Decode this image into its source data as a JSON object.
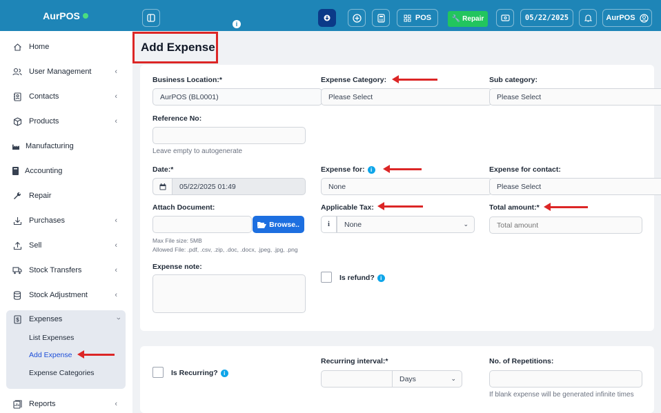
{
  "brand": {
    "name": "AurPOS"
  },
  "topbar": {
    "pos_label": "POS",
    "repair_label": "Repair",
    "date": "05/22/2025",
    "user": "AurPOS",
    "info": "i"
  },
  "sidebar": {
    "items": [
      {
        "label": "Home",
        "icon": "home-icon",
        "chevron": false
      },
      {
        "label": "User Management",
        "icon": "users-icon",
        "chevron": true
      },
      {
        "label": "Contacts",
        "icon": "contacts-icon",
        "chevron": true
      },
      {
        "label": "Products",
        "icon": "box-icon",
        "chevron": true
      },
      {
        "label": "Manufacturing",
        "icon": "factory-icon",
        "chevron": false
      },
      {
        "label": "Accounting",
        "icon": "book-icon",
        "chevron": false
      },
      {
        "label": "Repair",
        "icon": "wrench-icon",
        "chevron": false
      },
      {
        "label": "Purchases",
        "icon": "download-icon",
        "chevron": true
      },
      {
        "label": "Sell",
        "icon": "upload-icon",
        "chevron": true
      },
      {
        "label": "Stock Transfers",
        "icon": "truck-icon",
        "chevron": true
      },
      {
        "label": "Stock Adjustment",
        "icon": "database-icon",
        "chevron": true
      }
    ],
    "expenses": {
      "label": "Expenses",
      "icon": "dollar-icon",
      "sub": [
        "List Expenses",
        "Add Expense",
        "Expense Categories"
      ]
    },
    "reports": {
      "label": "Reports",
      "icon": "chart-icon"
    }
  },
  "page": {
    "title": "Add Expense"
  },
  "form": {
    "business_location": {
      "label": "Business Location:*",
      "value": "AurPOS (BL0001)"
    },
    "expense_category": {
      "label": "Expense Category:",
      "value": "Please Select"
    },
    "sub_category": {
      "label": "Sub category:",
      "value": "Please Select"
    },
    "reference_no": {
      "label": "Reference No:",
      "help": "Leave empty to autogenerate"
    },
    "date": {
      "label": "Date:*",
      "value": "05/22/2025 01:49"
    },
    "expense_for": {
      "label": "Expense for:",
      "value": "None"
    },
    "expense_for_contact": {
      "label": "Expense for contact:",
      "value": "Please Select"
    },
    "attach_document": {
      "label": "Attach Document:",
      "browse": "Browse..",
      "max_size": "Max File size: 5MB",
      "allowed": "Allowed File: .pdf, .csv, .zip, .doc, .docx, .jpeg, .jpg, .png"
    },
    "applicable_tax": {
      "label": "Applicable Tax:",
      "value": "None"
    },
    "total_amount": {
      "label": "Total amount:*",
      "placeholder": "Total amount"
    },
    "expense_note": {
      "label": "Expense note:"
    },
    "is_refund": {
      "label": "Is refund?"
    }
  },
  "recurring": {
    "is_recurring": {
      "label": "Is Recurring?"
    },
    "interval": {
      "label": "Recurring interval:*",
      "unit": "Days"
    },
    "repetitions": {
      "label": "No. of Repetitions:",
      "help": "If blank expense will be generated infinite times"
    }
  },
  "colors": {
    "topbar": "#1e85b7",
    "repair": "#22c55e",
    "browse": "#1d6fe0",
    "annotation": "#dc2626",
    "info": "#0ea5e9"
  }
}
